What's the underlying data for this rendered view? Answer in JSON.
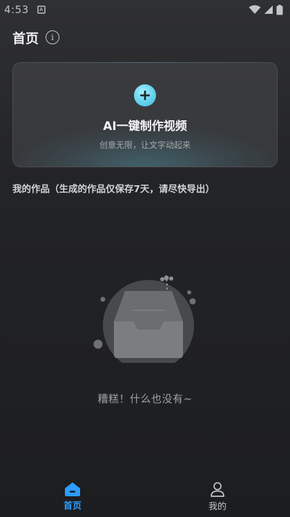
{
  "status_bar": {
    "time": "4:53",
    "icons": [
      "app-notification-icon",
      "wifi-icon",
      "signal-icon",
      "battery-icon"
    ]
  },
  "header": {
    "title": "首页",
    "info_icon": "info-icon"
  },
  "create_card": {
    "icon": "plus-icon",
    "title": "AI一键制作视频",
    "subtitle": "创意无限，让文字动起来"
  },
  "works": {
    "heading": "我的作品（生成的作品仅保存7天，请尽快导出）"
  },
  "empty_state": {
    "illustration": "empty-box-icon",
    "message": "糟糕！什么也没有~"
  },
  "bottom_nav": {
    "items": [
      {
        "label": "首页",
        "icon": "home-icon",
        "active": true
      },
      {
        "label": "我的",
        "icon": "profile-icon",
        "active": false
      }
    ]
  },
  "colors": {
    "accent_blue": "#2d9cff",
    "plus_cyan": "#63d3ee",
    "background": "#232427"
  }
}
